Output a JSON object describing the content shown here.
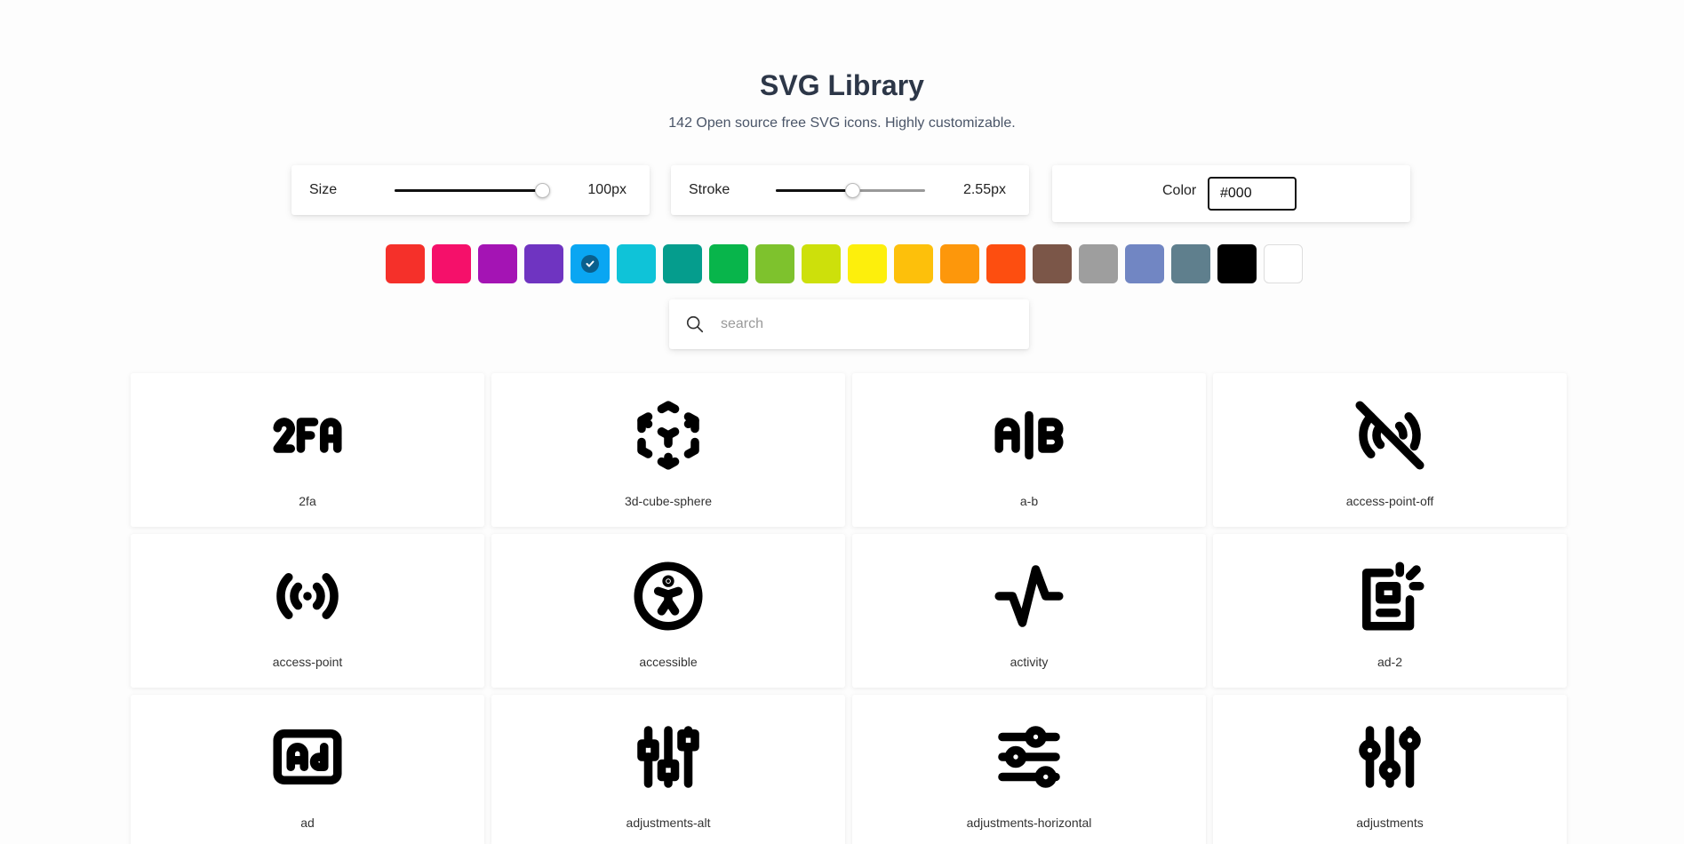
{
  "header": {
    "title": "SVG Library",
    "subtitle": "142 Open source free SVG icons. Highly customizable."
  },
  "controls": {
    "size": {
      "label": "Size",
      "value": "100px",
      "level": 0.95
    },
    "stroke": {
      "label": "Stroke",
      "value": "2.55px",
      "level": 0.51
    },
    "color": {
      "label": "Color",
      "value": "#000"
    }
  },
  "swatches": [
    {
      "color": "#f5302a",
      "selected": false
    },
    {
      "color": "#f5106a",
      "selected": false
    },
    {
      "color": "#a414b4",
      "selected": false
    },
    {
      "color": "#6f34c1",
      "selected": false
    },
    {
      "color": "#0aa6f2",
      "selected": true
    },
    {
      "color": "#0fc3d8",
      "selected": false
    },
    {
      "color": "#059d8d",
      "selected": false
    },
    {
      "color": "#08b54b",
      "selected": false
    },
    {
      "color": "#7ec22d",
      "selected": false
    },
    {
      "color": "#cde00b",
      "selected": false
    },
    {
      "color": "#fdef0c",
      "selected": false
    },
    {
      "color": "#fdc00b",
      "selected": false
    },
    {
      "color": "#fd970b",
      "selected": false
    },
    {
      "color": "#fd4e10",
      "selected": false
    },
    {
      "color": "#7b5648",
      "selected": false
    },
    {
      "color": "#9e9e9e",
      "selected": false
    },
    {
      "color": "#7186c3",
      "selected": false
    },
    {
      "color": "#5f7f8d",
      "selected": false
    },
    {
      "color": "#000000",
      "selected": false
    },
    {
      "color": "#ffffff",
      "selected": false
    }
  ],
  "search": {
    "placeholder": "search",
    "value": ""
  },
  "icons": [
    {
      "name": "2fa",
      "icon": "2fa-icon"
    },
    {
      "name": "3d-cube-sphere",
      "icon": "3d-cube-sphere-icon"
    },
    {
      "name": "a-b",
      "icon": "a-b-icon"
    },
    {
      "name": "access-point-off",
      "icon": "access-point-off-icon"
    },
    {
      "name": "access-point",
      "icon": "access-point-icon"
    },
    {
      "name": "accessible",
      "icon": "accessible-icon"
    },
    {
      "name": "activity",
      "icon": "activity-icon"
    },
    {
      "name": "ad-2",
      "icon": "ad-2-icon"
    },
    {
      "name": "ad",
      "icon": "ad-icon"
    },
    {
      "name": "adjustments-alt",
      "icon": "adjustments-alt-icon"
    },
    {
      "name": "adjustments-horizontal",
      "icon": "adjustments-horizontal-icon"
    },
    {
      "name": "adjustments",
      "icon": "adjustments-icon"
    }
  ]
}
